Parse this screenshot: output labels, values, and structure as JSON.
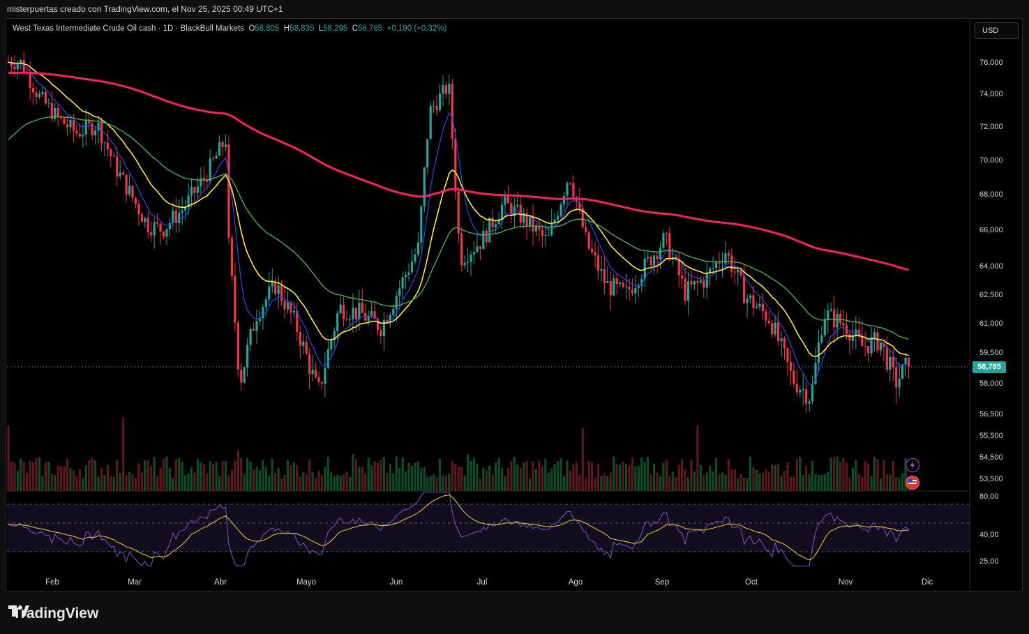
{
  "header": {
    "caption": "misterpuertas creado con TradingView.com, el Nov 25, 2025 00:49 UTC+1"
  },
  "legend": {
    "symbol": "West Texas Intermediate Crude Oil cash · 1D · BlackBull Markets",
    "o_label": "O",
    "o_value": "58,805",
    "h_label": "H",
    "h_value": "58,835",
    "l_label": "L",
    "l_value": "58,295",
    "c_label": "C",
    "c_value": "58,785",
    "change": "+0,190 (+0,32%)"
  },
  "currency_button": "USD",
  "last_price_tag": "58,785",
  "footer": {
    "brand": "TradingView"
  },
  "colors": {
    "up": "#26a69a",
    "down": "#f23645",
    "ema_fast": "#3a47d9",
    "ema_mid": "#ffeb3b",
    "ema_slow": "#4caf50",
    "ema_long": "#f7235f",
    "rsi": "#7e57c2",
    "rsi_ma": "#f5d142"
  },
  "chart_data": [
    {
      "type": "candlestick",
      "title": "West Texas Intermediate Crude Oil cash",
      "price_axis_ticks": [
        "76,000",
        "74,000",
        "72,000",
        "70,000",
        "68,000",
        "66,000",
        "64,000",
        "62,500",
        "61,000",
        "59,500",
        "58,000",
        "56,500",
        "55,500",
        "54,500",
        "53,500"
      ],
      "price_axis_values": [
        76000,
        74000,
        72000,
        70000,
        68000,
        66000,
        64000,
        62500,
        61000,
        59500,
        58000,
        56500,
        55500,
        54500,
        53500
      ],
      "time_axis_labels": [
        "Feb",
        "Mar",
        "Abr",
        "Mayo",
        "Jun",
        "Jul",
        "Ago",
        "Sep",
        "Oct",
        "Nov",
        "Dic"
      ],
      "ylim": [
        53000,
        77500
      ],
      "approx_close_path": [
        {
          "x": "Ene-20",
          "y": 76.0
        },
        {
          "x": "Ene-27",
          "y": 73.8
        },
        {
          "x": "Feb-03",
          "y": 72.5
        },
        {
          "x": "Feb-10",
          "y": 71.6
        },
        {
          "x": "Feb-18",
          "y": 72.1
        },
        {
          "x": "Feb-25",
          "y": 69.5
        },
        {
          "x": "Mar-05",
          "y": 66.3
        },
        {
          "x": "Mar-10",
          "y": 66.0
        },
        {
          "x": "Mar-17",
          "y": 67.2
        },
        {
          "x": "Mar-24",
          "y": 69.0
        },
        {
          "x": "Mar-31",
          "y": 71.3
        },
        {
          "x": "Abr-03",
          "y": 66.9
        },
        {
          "x": "Abr-08",
          "y": 58.0
        },
        {
          "x": "Abr-14",
          "y": 61.5
        },
        {
          "x": "Abr-21",
          "y": 63.0
        },
        {
          "x": "Abr-28",
          "y": 61.0
        },
        {
          "x": "May-05",
          "y": 57.5
        },
        {
          "x": "May-12",
          "y": 61.8
        },
        {
          "x": "May-19",
          "y": 61.5
        },
        {
          "x": "May-26",
          "y": 60.8
        },
        {
          "x": "Jun-02",
          "y": 62.8
        },
        {
          "x": "Jun-09",
          "y": 65.0
        },
        {
          "x": "Jun-13",
          "y": 72.9
        },
        {
          "x": "Jun-20",
          "y": 74.5
        },
        {
          "x": "Jun-24",
          "y": 64.4
        },
        {
          "x": "Jul-01",
          "y": 65.4
        },
        {
          "x": "Jul-08",
          "y": 67.5
        },
        {
          "x": "Jul-15",
          "y": 66.5
        },
        {
          "x": "Jul-22",
          "y": 65.3
        },
        {
          "x": "Jul-29",
          "y": 69.2
        },
        {
          "x": "Ago-05",
          "y": 65.2
        },
        {
          "x": "Ago-12",
          "y": 63.0
        },
        {
          "x": "Ago-19",
          "y": 62.5
        },
        {
          "x": "Ago-26",
          "y": 64.0
        },
        {
          "x": "Sep-02",
          "y": 65.5
        },
        {
          "x": "Sep-09",
          "y": 62.6
        },
        {
          "x": "Sep-16",
          "y": 63.3
        },
        {
          "x": "Sep-23",
          "y": 64.8
        },
        {
          "x": "Sep-30",
          "y": 62.4
        },
        {
          "x": "Oct-07",
          "y": 61.2
        },
        {
          "x": "Oct-14",
          "y": 58.2
        },
        {
          "x": "Oct-20",
          "y": 57.3
        },
        {
          "x": "Oct-24",
          "y": 61.5
        },
        {
          "x": "Oct-31",
          "y": 60.9
        },
        {
          "x": "Nov-07",
          "y": 59.8
        },
        {
          "x": "Nov-14",
          "y": 60.1
        },
        {
          "x": "Nov-20",
          "y": 58.0
        },
        {
          "x": "Nov-24",
          "y": 58.785
        }
      ],
      "moving_averages": [
        "ema_fast (blue)",
        "ema_mid (yellow)",
        "ema_slow (green)",
        "ema_long (pink)"
      ],
      "last_close": 58.785
    },
    {
      "type": "line",
      "title": "RSI",
      "axis_ticks": [
        "80,00",
        "40,00",
        "25,00"
      ],
      "axis_values": [
        80,
        40,
        25
      ],
      "ylim": [
        20,
        85
      ],
      "levels": [
        70,
        50,
        30
      ]
    }
  ]
}
